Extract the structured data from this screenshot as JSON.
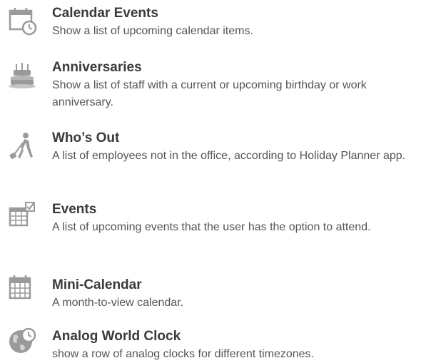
{
  "widgets": [
    {
      "title": "Calendar Events",
      "description": "Show a list of upcoming calendar items.",
      "icon": "calendar-clock-icon"
    },
    {
      "title": "Anniversaries",
      "description": "Show a list of staff with a current or upcoming birthday or work anniversary.",
      "icon": "birthday-cake-icon"
    },
    {
      "title": "Who’s Out",
      "description": "A list of employees not in the office, according to Holiday Planner app.",
      "icon": "traveler-icon"
    },
    {
      "title": "Events",
      "description": "A list of upcoming events that the user has the option to attend.",
      "icon": "calendar-check-icon"
    },
    {
      "title": "Mini-Calendar",
      "description": "A month-to-view calendar.",
      "icon": "calendar-grid-icon"
    },
    {
      "title": "Analog World Clock",
      "description": "show a row of analog clocks for different timezones.",
      "icon": "globe-clock-icon"
    }
  ],
  "colors": {
    "icon": "#9a9a9a",
    "title": "#3a3a3a",
    "text": "#555555"
  }
}
